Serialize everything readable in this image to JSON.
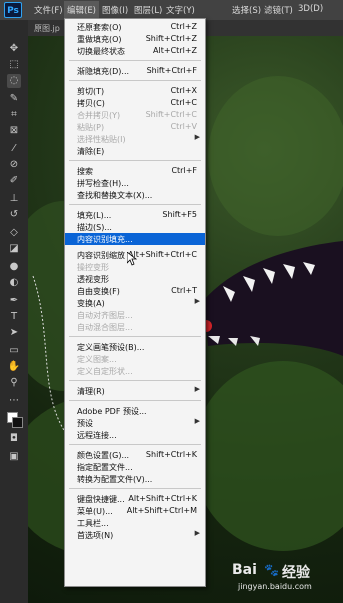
{
  "menubar": {
    "logo": "Ps",
    "items": [
      "文件(F)",
      "编辑(E)",
      "图像(I)",
      "图层(L)",
      "文字(Y)",
      "选择(S)",
      "滤镜(T)",
      "3D(D)"
    ]
  },
  "tab": {
    "title": "原图.jp"
  },
  "edit_menu": {
    "items": [
      {
        "label": "还原套索(O)",
        "shortcut": "Ctrl+Z"
      },
      {
        "label": "重做填充(O)",
        "shortcut": "Shift+Ctrl+Z"
      },
      {
        "label": "切换最终状态",
        "shortcut": "Alt+Ctrl+Z"
      },
      {
        "label": "渐隐填充(D)...",
        "shortcut": "Shift+Ctrl+F"
      },
      {
        "label": "剪切(T)",
        "shortcut": "Ctrl+X"
      },
      {
        "label": "拷贝(C)",
        "shortcut": "Ctrl+C"
      },
      {
        "label": "合并拷贝(Y)",
        "shortcut": "Shift+Ctrl+C"
      },
      {
        "label": "粘贴(P)",
        "shortcut": "Ctrl+V"
      },
      {
        "label": "选择性粘贴(I)",
        "shortcut": ""
      },
      {
        "label": "清除(E)",
        "shortcut": ""
      },
      {
        "label": "搜索",
        "shortcut": "Ctrl+F"
      },
      {
        "label": "拼写检查(H)...",
        "shortcut": ""
      },
      {
        "label": "查找和替换文本(X)...",
        "shortcut": ""
      },
      {
        "label": "填充(L)...",
        "shortcut": "Shift+F5"
      },
      {
        "label": "描边(S)...",
        "shortcut": ""
      },
      {
        "label": "内容识别填充...",
        "shortcut": ""
      },
      {
        "label": "内容识别缩放",
        "shortcut": "Alt+Shift+Ctrl+C"
      },
      {
        "label": "操控变形",
        "shortcut": ""
      },
      {
        "label": "透视变形",
        "shortcut": ""
      },
      {
        "label": "自由变换(F)",
        "shortcut": "Ctrl+T"
      },
      {
        "label": "变换(A)",
        "shortcut": ""
      },
      {
        "label": "自动对齐图层...",
        "shortcut": ""
      },
      {
        "label": "自动混合图层...",
        "shortcut": ""
      },
      {
        "label": "定义画笔预设(B)...",
        "shortcut": ""
      },
      {
        "label": "定义图案...",
        "shortcut": ""
      },
      {
        "label": "定义自定形状...",
        "shortcut": ""
      },
      {
        "label": "清理(R)",
        "shortcut": ""
      },
      {
        "label": "Adobe PDF 预设...",
        "shortcut": ""
      },
      {
        "label": "预设",
        "shortcut": ""
      },
      {
        "label": "远程连接...",
        "shortcut": ""
      },
      {
        "label": "颜色设置(G)...",
        "shortcut": "Shift+Ctrl+K"
      },
      {
        "label": "指定配置文件...",
        "shortcut": ""
      },
      {
        "label": "转换为配置文件(V)...",
        "shortcut": ""
      },
      {
        "label": "键盘快捷键...",
        "shortcut": "Alt+Shift+Ctrl+K"
      },
      {
        "label": "菜单(U)...",
        "shortcut": "Alt+Shift+Ctrl+M"
      },
      {
        "label": "工具栏...",
        "shortcut": ""
      },
      {
        "label": "首选项(N)",
        "shortcut": ""
      }
    ]
  },
  "watermark": {
    "brand": "Bai",
    "name": "经验",
    "url": "jingyan.baidu.com"
  },
  "colors": {
    "highlight": "#0a64d6",
    "menu_bg": "#f4f4f4",
    "app_bg": "#424242"
  }
}
